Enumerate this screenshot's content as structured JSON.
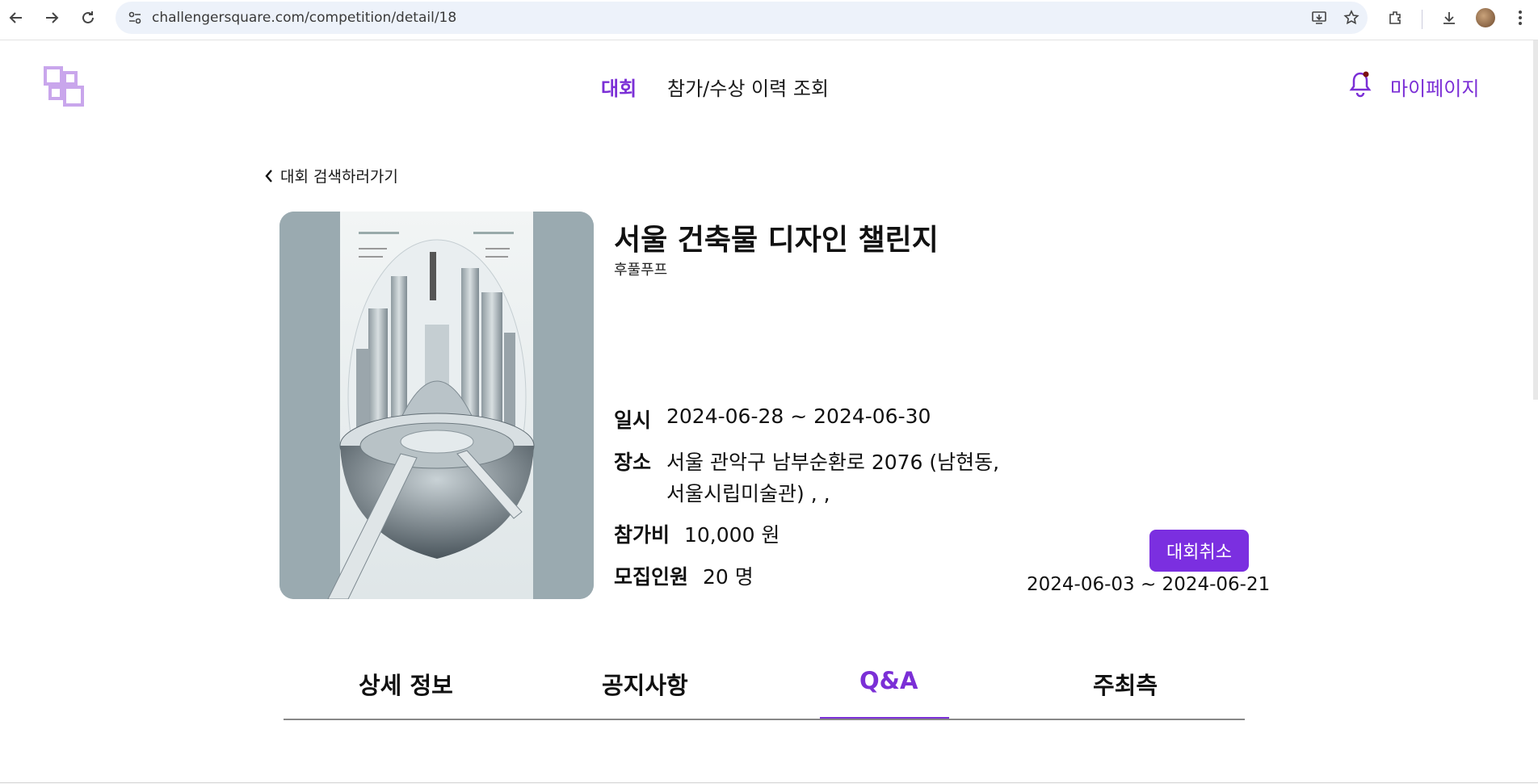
{
  "browser": {
    "url": "challengersquare.com/competition/detail/18",
    "icons": [
      "back-arrow-icon",
      "forward-arrow-icon",
      "reload-icon",
      "site-settings-icon",
      "install-app-icon",
      "bookmark-star-icon",
      "extensions-icon",
      "download-icon",
      "profile-avatar",
      "menu-dots-icon"
    ]
  },
  "header": {
    "nav_competition": "대회",
    "nav_history": "참가/수상 이력 조회",
    "mypage": "마이페이지"
  },
  "back_link": "대회 검색하러가기",
  "competition": {
    "title": "서울 건축물 디자인 챌린지",
    "organizer": "후풀푸프",
    "date_label": "일시",
    "date_value": "2024-06-28 ~ 2024-06-30",
    "place_label": "장소",
    "place_line1": "서울 관악구 남부순환로 2076 (남현동,",
    "place_line2": "서울시립미술관) , ,",
    "fee_label": "참가비",
    "fee_value": "10,000 원",
    "capacity_label": "모집인원",
    "capacity_value": "20 명",
    "cancel_button": "대회취소",
    "apply_period": "2024-06-03 ~ 2024-06-21"
  },
  "tabs": [
    {
      "label": "상세 정보",
      "active": false
    },
    {
      "label": "공지사항",
      "active": false
    },
    {
      "label": "Q&A",
      "active": true
    },
    {
      "label": "주최측",
      "active": false
    }
  ],
  "colors": {
    "accent": "#7b2fd6",
    "button": "#7b2fe0",
    "omnibox": "#edf2fa"
  }
}
